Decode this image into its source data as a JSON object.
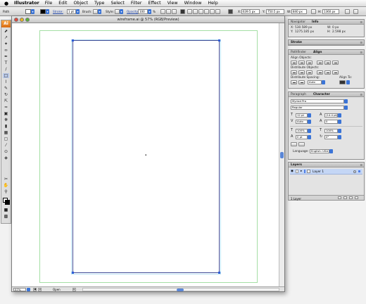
{
  "menubar": {
    "apple": "",
    "app": "Illustrator",
    "items": [
      "File",
      "Edit",
      "Object",
      "Type",
      "Select",
      "Filter",
      "Effect",
      "View",
      "Window",
      "Help"
    ]
  },
  "controlbar": {
    "object_type": "Path",
    "stroke_label": "Stroke:",
    "stroke_weight": "1 pt",
    "brush_label": "Brush:",
    "style_label": "Style:",
    "opacity_label": "Opacity:",
    "opacity_value": "100",
    "opacity_unit": "%",
    "x_label": "X:",
    "x_value": "639.5 px",
    "y_label": "Y:",
    "y_value": "750.5 px",
    "w_label": "W:",
    "w_value": "840 px",
    "h_label": "H:",
    "h_value": "1360 px"
  },
  "document": {
    "title": "wireframe.ai @ 57% (RGB/Preview)",
    "zoom": "57%",
    "status": "Open"
  },
  "panels": {
    "navigator": {
      "tabs": [
        "Navigator",
        "Info"
      ],
      "x_label": "X:",
      "x_value": "530.589 px",
      "y_label": "Y:",
      "y_value": "1275.185 px",
      "w_label": "W:",
      "w_value": "0 px",
      "h_label": "H:",
      "h_value": "2.598 px"
    },
    "stroke": {
      "tabs": [
        "Stroke"
      ]
    },
    "align": {
      "tabs": [
        "Pathfinder",
        "Align"
      ],
      "align_objects": "Align Objects:",
      "distribute_objects": "Distribute Objects:",
      "distribute_spacing": "Distribute Spacing:",
      "align_to": "Align To:",
      "spacing_value": "Auto"
    },
    "character": {
      "tabs": [
        "Paragraph",
        "Character"
      ],
      "font_family": "Myriad Pro",
      "font_style": "Regular",
      "size": "12 pt",
      "leading": "(14.4 pt)",
      "kerning": "Auto",
      "tracking": "0",
      "vscale": "100%",
      "hscale": "100%",
      "baseline": "0 pt",
      "rotation": "0°",
      "language_label": "Language:",
      "language": "English: USA"
    },
    "layers": {
      "tabs": [
        "Layers"
      ],
      "layer_name": "Layer 1",
      "count": "1 Layer"
    }
  }
}
